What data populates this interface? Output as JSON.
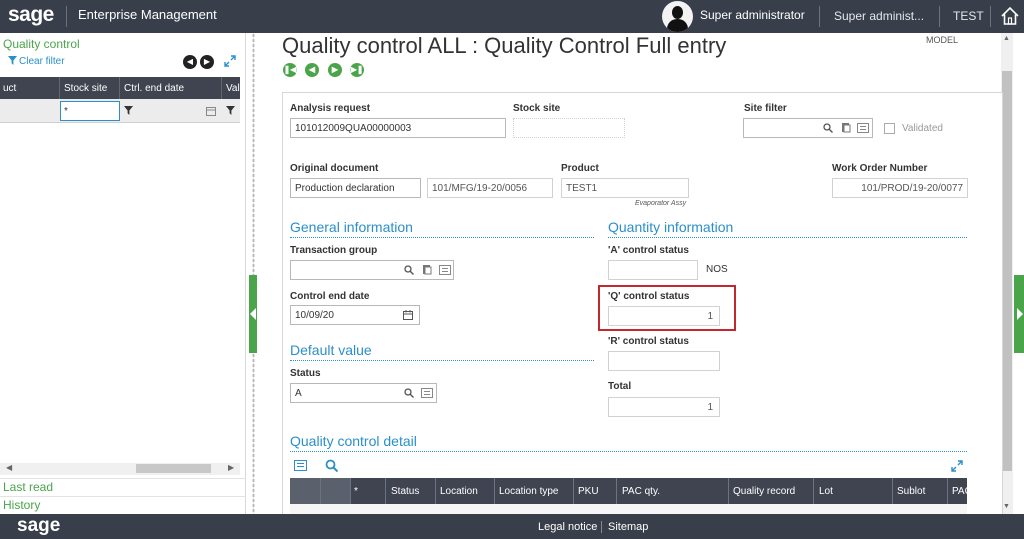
{
  "header": {
    "logo": "sage",
    "app_title": "Enterprise Management",
    "user": "Super administrator",
    "role": "Super administ...",
    "folder": "TEST"
  },
  "left_panel": {
    "title": "Quality control",
    "clear_filter": "Clear filter",
    "columns": [
      "uct",
      "Stock site",
      "Ctrl. end date",
      "Val"
    ],
    "stock_site_filter": "*",
    "links": [
      "Last read",
      "History"
    ]
  },
  "page": {
    "title": "Quality control ALL : Quality Control Full entry",
    "model": "MODEL"
  },
  "form": {
    "analysis_request": {
      "label": "Analysis request",
      "value": "101012009QUA00000003"
    },
    "stock_site": {
      "label": "Stock site",
      "value": ""
    },
    "site_filter": {
      "label": "Site filter",
      "value": ""
    },
    "validated": {
      "label": "Validated",
      "checked": false
    },
    "original_document": {
      "label": "Original document",
      "type": "Production declaration",
      "number": "101/MFG/19-20/0056"
    },
    "product": {
      "label": "Product",
      "value": "TEST1",
      "description": "Evaporator Assy"
    },
    "work_order": {
      "label": "Work Order Number",
      "value": "101/PROD/19-20/0077"
    },
    "general": {
      "title": "General information",
      "transaction_group": {
        "label": "Transaction group",
        "value": ""
      },
      "control_end_date": {
        "label": "Control end date",
        "value": "10/09/20"
      }
    },
    "default_value": {
      "title": "Default value",
      "status": {
        "label": "Status",
        "value": "A"
      }
    },
    "quantity": {
      "title": "Quantity information",
      "a_status": {
        "label": "'A' control status",
        "value": "",
        "unit": "NOS"
      },
      "q_status": {
        "label": "'Q' control status",
        "value": "1"
      },
      "r_status": {
        "label": "'R' control status",
        "value": ""
      },
      "total": {
        "label": "Total",
        "value": "1"
      }
    },
    "detail": {
      "title": "Quality control detail",
      "columns": [
        "*",
        "Status",
        "Location",
        "Location type",
        "PKU",
        "PAC qty.",
        "Quality record",
        "Lot",
        "Sublot",
        "PAC"
      ]
    }
  },
  "footer": {
    "logo": "sage",
    "legal": "Legal notice",
    "sitemap": "Sitemap"
  },
  "colors": {
    "topbar": "#383e4a",
    "accent_green": "#4aa54a",
    "section_blue": "#2b8fc9",
    "highlight_red": "#c0282d"
  }
}
